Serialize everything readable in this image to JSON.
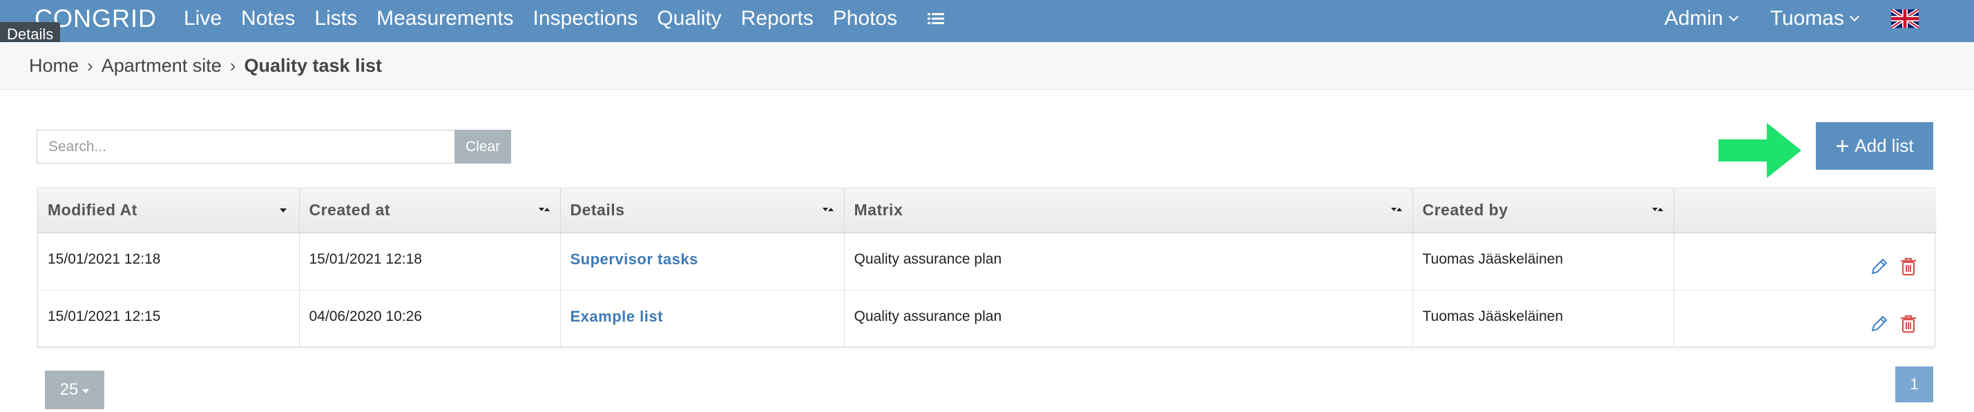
{
  "app": {
    "logo": "CONGRID"
  },
  "nav": {
    "links": [
      "Live",
      "Notes",
      "Lists",
      "Measurements",
      "Inspections",
      "Quality",
      "Reports",
      "Photos"
    ],
    "admin_label": "Admin",
    "user_label": "Tuomas",
    "tooltip": "Details",
    "list_icon": "list-icon",
    "flag_icon": "uk-flag-icon"
  },
  "breadcrumb": {
    "items": [
      "Home",
      "Apartment site"
    ],
    "current": "Quality task list"
  },
  "search": {
    "placeholder": "Search...",
    "value": "",
    "clear_label": "Clear"
  },
  "toolbar": {
    "add_label": "Add list"
  },
  "table": {
    "columns": [
      "Modified At",
      "Created at",
      "Details",
      "Matrix",
      "Created by",
      ""
    ],
    "rows": [
      {
        "modified_at": "15/01/2021 12:18",
        "created_at": "15/01/2021 12:18",
        "details": "Supervisor tasks",
        "matrix": "Quality assurance plan",
        "created_by": "Tuomas Jääskeläinen"
      },
      {
        "modified_at": "15/01/2021 12:15",
        "created_at": "04/06/2020 10:26",
        "details": "Example list",
        "matrix": "Quality assurance plan",
        "created_by": "Tuomas Jääskeläinen"
      }
    ]
  },
  "pagination": {
    "page_size": "25",
    "current_page": "1"
  },
  "colors": {
    "brand": "#5b8fbf",
    "link": "#3d7ab8",
    "delete": "#d9534f",
    "arrow": "#1de26b"
  }
}
